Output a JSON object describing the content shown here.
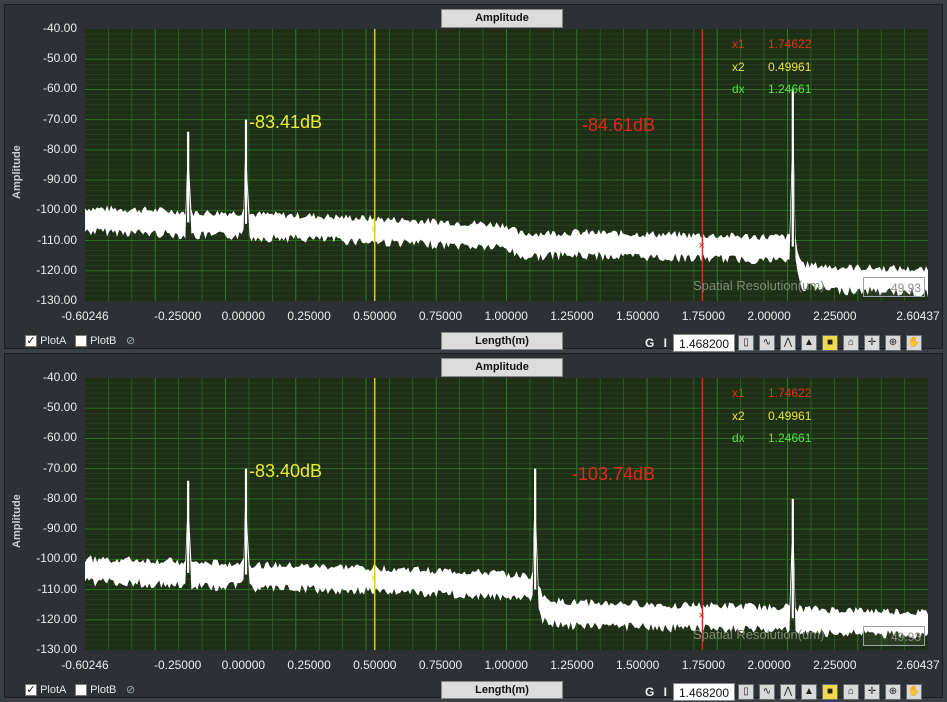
{
  "panels": [
    {
      "top_tab": "Amplitude",
      "bottom_tab": "Length(m)",
      "ylabel": "Amplitude",
      "yticks": [
        "-40.00",
        "-50.00",
        "-60.00",
        "-70.00",
        "-80.00",
        "-90.00",
        "-100.00",
        "-110.00",
        "-120.00",
        "-130.00"
      ],
      "xticks": [
        "-0.60246",
        "-0.25000",
        "0.00000",
        "0.25000",
        "0.50000",
        "0.75000",
        "1.00000",
        "1.25000",
        "1.50000",
        "1.75000",
        "2.00000",
        "2.25000",
        "2.60437"
      ],
      "cursor_readout": {
        "x1_label": "x1",
        "x1_value": "1.74622",
        "x2_label": "x2",
        "x2_value": "0.49961",
        "dx_label": "dx",
        "dx_value": "1.24661"
      },
      "annotation_left": "-83.41dB",
      "annotation_right": "-84.61dB",
      "spatial_label": "Spatial Resolution(um)",
      "spatial_value": "49.93",
      "plotA": "PlotA",
      "plotB": "PlotB",
      "gi": "G I",
      "field_value": "1.468200"
    },
    {
      "top_tab": "Amplitude",
      "bottom_tab": "Length(m)",
      "ylabel": "Amplitude",
      "yticks": [
        "-40.00",
        "-50.00",
        "-60.00",
        "-70.00",
        "-80.00",
        "-90.00",
        "-100.00",
        "-110.00",
        "-120.00",
        "-130.00"
      ],
      "xticks": [
        "-0.60246",
        "-0.25000",
        "0.00000",
        "0.25000",
        "0.50000",
        "0.75000",
        "1.00000",
        "1.25000",
        "1.50000",
        "1.75000",
        "2.00000",
        "2.25000",
        "2.60437"
      ],
      "cursor_readout": {
        "x1_label": "x1",
        "x1_value": "1.74622",
        "x2_label": "x2",
        "x2_value": "0.49961",
        "dx_label": "dx",
        "dx_value": "1.24661"
      },
      "annotation_left": "-83.40dB",
      "annotation_right": "-103.74dB",
      "spatial_label": "Spatial Resolution(um)",
      "spatial_value": "49.93",
      "plotA": "PlotA",
      "plotB": "PlotB",
      "gi": "G I",
      "field_value": "1.468200"
    }
  ],
  "colors": {
    "background": "#1f2e16",
    "grid": "#2f7a2a",
    "trace": "#ffffff",
    "cursor_x2": "#e8c33a",
    "cursor_x1": "#c8301f",
    "x1_text": "#e03020",
    "x2_text": "#e8e23a",
    "dx_text": "#54e040"
  },
  "chart_data": [
    {
      "type": "line",
      "ylabel": "Amplitude",
      "xlabel": "Length(m)",
      "xlim": [
        -0.60246,
        2.60437
      ],
      "ylim": [
        -130,
        -40
      ],
      "cursors": {
        "x1": 1.74622,
        "x2": 0.49961
      },
      "series": [
        {
          "x": [
            -0.60246,
            -0.4,
            -0.25,
            -0.22,
            -0.21,
            -0.2,
            0.0,
            0.01,
            0.02,
            0.25,
            0.5,
            0.75,
            1.0,
            1.05,
            1.25,
            1.5,
            1.75,
            2.0,
            2.08,
            2.09,
            2.1,
            2.11,
            2.13,
            2.25,
            2.5,
            2.60437
          ],
          "y": [
            -102.5,
            -103,
            -103.5,
            -104,
            -74,
            -104,
            -104,
            -70,
            -104.5,
            -105,
            -106,
            -107,
            -108,
            -111,
            -110.5,
            -111,
            -111.5,
            -112,
            -112,
            -60,
            -112,
            -118,
            -121,
            -122,
            -122.5,
            -123
          ]
        }
      ]
    },
    {
      "type": "line",
      "ylabel": "Amplitude",
      "xlabel": "Length(m)",
      "xlim": [
        -0.60246,
        2.60437
      ],
      "ylim": [
        -130,
        -40
      ],
      "cursors": {
        "x1": 1.74622,
        "x2": 0.49961
      },
      "series": [
        {
          "x": [
            -0.60246,
            -0.4,
            -0.25,
            -0.22,
            -0.21,
            -0.2,
            0.0,
            0.01,
            0.02,
            0.25,
            0.5,
            0.75,
            1.0,
            1.1,
            1.11,
            1.12,
            1.14,
            1.2,
            1.25,
            1.5,
            1.75,
            2.0,
            2.08,
            2.09,
            2.1,
            2.25,
            2.5,
            2.60437
          ],
          "y": [
            -103,
            -103.5,
            -104,
            -104,
            -74,
            -104.5,
            -104.5,
            -70,
            -105,
            -105.5,
            -106,
            -107,
            -108,
            -109,
            -70,
            -110,
            -116,
            -117,
            -117.5,
            -118,
            -118.5,
            -119,
            -119,
            -80,
            -119.5,
            -120,
            -120.5,
            -121
          ]
        }
      ]
    }
  ]
}
